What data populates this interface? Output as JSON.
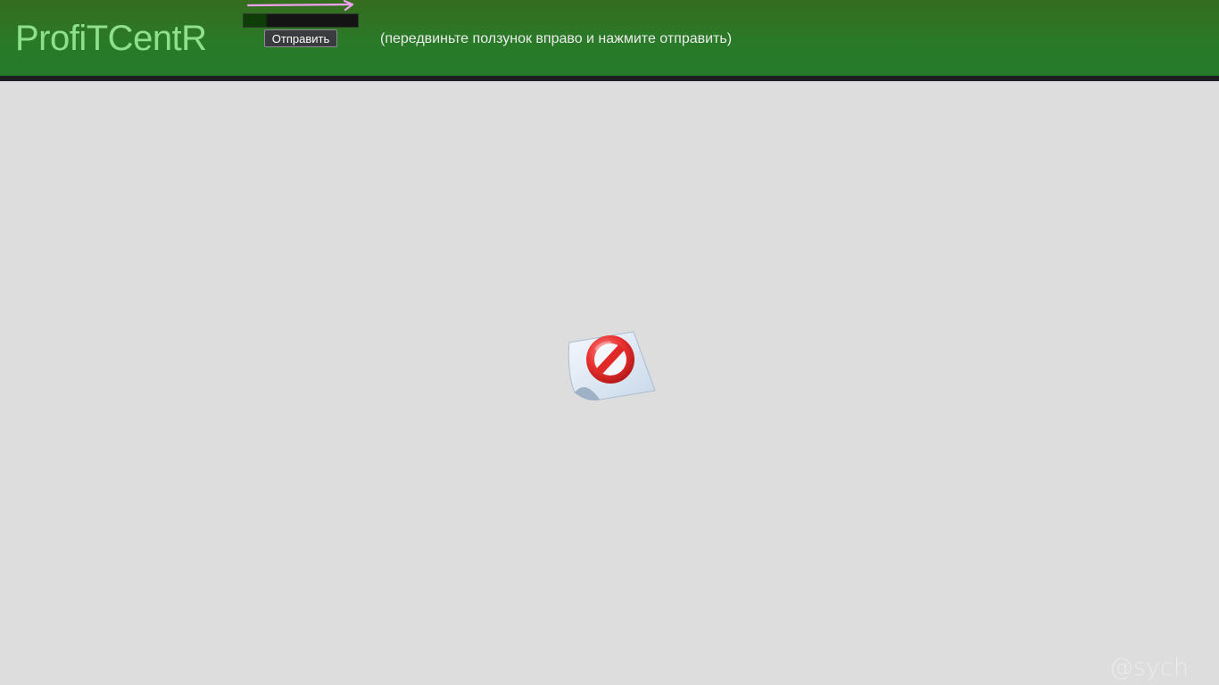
{
  "header": {
    "logo_text": "ProfiTCentR",
    "submit_label": "Отправить",
    "hint_text": "(передвиньте ползунок вправо и нажмите отправить)",
    "slider_value_fraction": 0.21,
    "colors": {
      "header_top": "#356c1e",
      "header_bottom": "#237b2a",
      "logo": "#8ee08a",
      "slider_track": "#141414",
      "slider_fill": "#0f3d08",
      "arrow": "#f2a0f0"
    }
  },
  "main": {
    "center_icon": "blocked-content-icon",
    "watermark": "@sych",
    "background": "#dddddd"
  }
}
